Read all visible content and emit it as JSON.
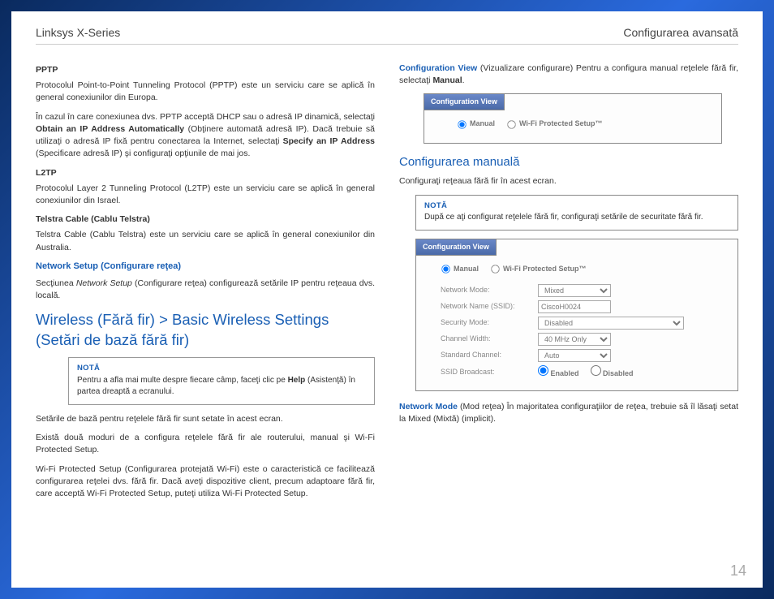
{
  "header": {
    "left": "Linksys X-Series",
    "right": "Configurarea avansată"
  },
  "left": {
    "pptp_h": "PPTP",
    "pptp_p1": "Protocolul Point-to-Point Tunneling Protocol (PPTP) este un serviciu care se aplică în general conexiunilor din Europa.",
    "pptp_p2a": "În cazul în care conexiunea dvs. PPTP acceptă DHCP sau o adresă IP dinamică, selectaţi ",
    "pptp_p2b": "Obtain an IP Address Automatically",
    "pptp_p2c": " (Obţinere automată adresă IP). Dacă trebuie să utilizaţi o adresă IP fixă pentru conectarea la Internet, selectaţi ",
    "pptp_p2d": "Specify an IP Address",
    "pptp_p2e": " (Specificare adresă IP) şi configuraţi opţiunile de mai jos.",
    "l2tp_h": "L2TP",
    "l2tp_p": "Protocolul Layer 2 Tunneling Protocol (L2TP) este un serviciu care se aplică în general conexiunilor din Israel.",
    "telstra_h": "Telstra Cable (Cablu Telstra)",
    "telstra_p": "Telstra Cable (Cablu Telstra) este un serviciu care se aplică în general conexiunilor din Australia.",
    "netset_h": "Network Setup (Configurare reţea)",
    "netset_p_a": "Secţiunea ",
    "netset_p_b": "Network Setup",
    "netset_p_c": " (Configurare reţea) configurează setările IP pentru reţeaua dvs. locală.",
    "wireless_h": "Wireless (Fără fir) > Basic Wireless Settings (Setări de bază fără fir)",
    "note_t": "NOTĂ",
    "note_a": "Pentru a afla mai multe despre fiecare câmp, faceţi clic pe ",
    "note_b": "Help",
    "note_c": " (Asistenţă) în partea dreaptă a ecranului.",
    "p_after1": "Setările de bază pentru reţelele fără fir sunt setate în acest ecran.",
    "p_after2": "Există două moduri de a configura reţelele fără fir ale routerului, manual şi Wi-Fi Protected Setup.",
    "p_after3": "Wi-Fi Protected Setup (Configurarea protejată Wi-Fi) este o caracteristică ce facilitează configurarea reţelei dvs. fără fir. Dacă aveţi dispozitive client, precum adaptoare fără fir, care acceptă Wi-Fi Protected Setup, puteţi utiliza Wi-Fi Protected Setup."
  },
  "right": {
    "cfgview_a": "Configuration View",
    "cfgview_b": " (Vizualizare configurare) Pentru a configura manual reţelele fără fir, selectaţi ",
    "cfgview_c": "Manual",
    "cfgview_d": ".",
    "panel1": {
      "hdr": "Configuration View",
      "opt_manual": "Manual",
      "opt_wps": "Wi-Fi Protected Setup™"
    },
    "man_h": "Configurarea manuală",
    "man_p": "Configuraţi reţeaua fără fir în acest ecran.",
    "note_t": "NOTĂ",
    "note_txt": "După ce aţi configurat reţelele fără fir, configuraţi setările de securitate fără fir.",
    "panel2": {
      "hdr": "Configuration View",
      "opt_manual": "Manual",
      "opt_wps": "Wi-Fi Protected Setup™",
      "row_nm": "Network Mode:",
      "val_nm": "Mixed",
      "row_ssid": "Network Name (SSID):",
      "val_ssid": "CiscoH0024",
      "row_sec": "Security Mode:",
      "val_sec": "Disabled",
      "row_cw": "Channel Width:",
      "val_cw": "40 MHz Only",
      "row_ch": "Standard Channel:",
      "val_ch": "Auto",
      "row_bc": "SSID Broadcast:",
      "val_en": "Enabled",
      "val_dis": "Disabled"
    },
    "nmode_a": "Network Mode",
    "nmode_b": "  (Mod reţea) În majoritatea configuraţiilor de reţea, trebuie să îl lăsaţi setat la Mixed (Mixtă) (implicit)."
  },
  "pagenum": "14"
}
